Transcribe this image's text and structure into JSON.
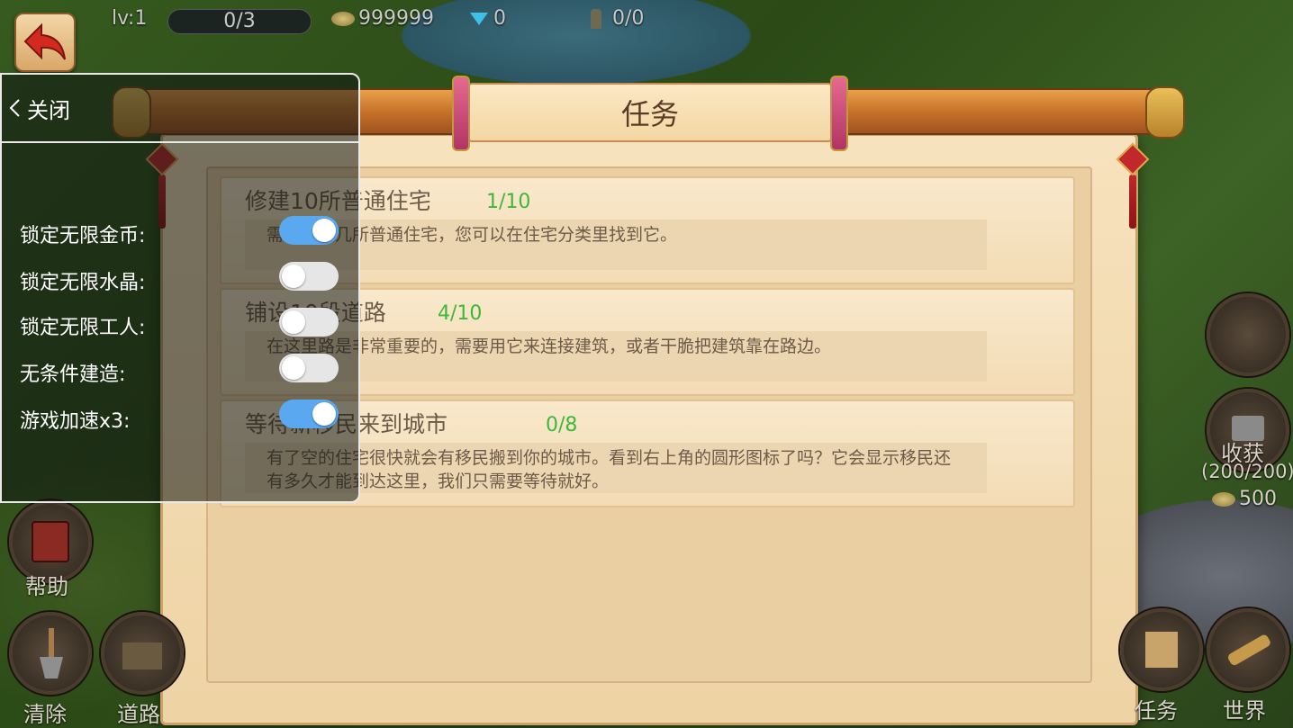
{
  "hud": {
    "level": "lv:1",
    "population": "0/3",
    "coins": "999999",
    "gems": "0",
    "workers": "0/0"
  },
  "panel": {
    "title": "任务",
    "quests": [
      {
        "title": "修建10所普通住宅",
        "progress": "1/10",
        "desc": "需要修建几所普通住宅，您可以在住宅分类里找到它。"
      },
      {
        "title": "铺设10段道路",
        "progress": "4/10",
        "desc": "在这里路是非常重要的，需要用它来连接建筑，或者干脆把建筑靠在路边。"
      },
      {
        "title": "等待新移民来到城市",
        "progress": "0/8",
        "desc": "有了空的住宅很快就会有移民搬到你的城市。看到右上角的圆形图标了吗？它会显示移民还有多久才能到达这里，我们只需要等待就好。"
      }
    ]
  },
  "side": {
    "help": "帮助",
    "clear": "清除",
    "road": "道路",
    "harvest": "收获",
    "harvest_count": "(200/200)",
    "harvest_coins": "500",
    "task": "任务",
    "world": "世界"
  },
  "overlay": {
    "close_label": "关闭",
    "options": [
      {
        "label": "锁定无限金币:",
        "on": true
      },
      {
        "label": "锁定无限水晶:",
        "on": false
      },
      {
        "label": "锁定无限工人:",
        "on": false
      },
      {
        "label": "无条件建造:",
        "on": false
      },
      {
        "label": "游戏加速x3:",
        "on": true
      }
    ]
  },
  "colors": {
    "progress_green": "#3cb83a",
    "toggle_on": "#5aa8f0",
    "toggle_off": "#e6e6e6"
  },
  "icons": [
    "back-arrow-icon",
    "coin-icon",
    "gem-icon",
    "worker-icon",
    "book-icon",
    "shovel-icon",
    "road-icon",
    "tv-icon",
    "map-icon",
    "telescope-icon",
    "chevron-left-icon"
  ]
}
